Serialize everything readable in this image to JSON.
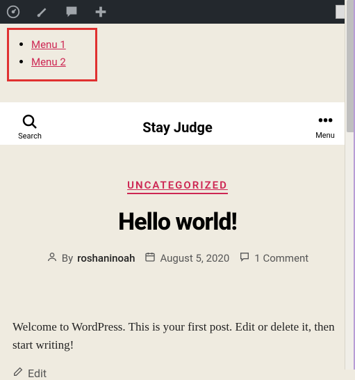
{
  "adminbar": {
    "icons": [
      "dashboard-icon",
      "brush-icon",
      "comment-icon",
      "plus-icon"
    ]
  },
  "highlight_menu": {
    "items": [
      "Menu 1",
      "Menu 2"
    ]
  },
  "header": {
    "site_title": "Stay Judge",
    "search_label": "Search",
    "menu_label": "Menu"
  },
  "post": {
    "category": "UNCATEGORIZED",
    "title": "Hello world!",
    "by_label": "By",
    "author": "roshaninoah",
    "date": "August 5, 2020",
    "comments": "1 Comment",
    "body": "Welcome to WordPress. This is your first post. Edit or delete it, then start writing!",
    "edit_label": "Edit"
  },
  "colors": {
    "accent": "#cd2653",
    "highlight_border": "#e03030"
  }
}
